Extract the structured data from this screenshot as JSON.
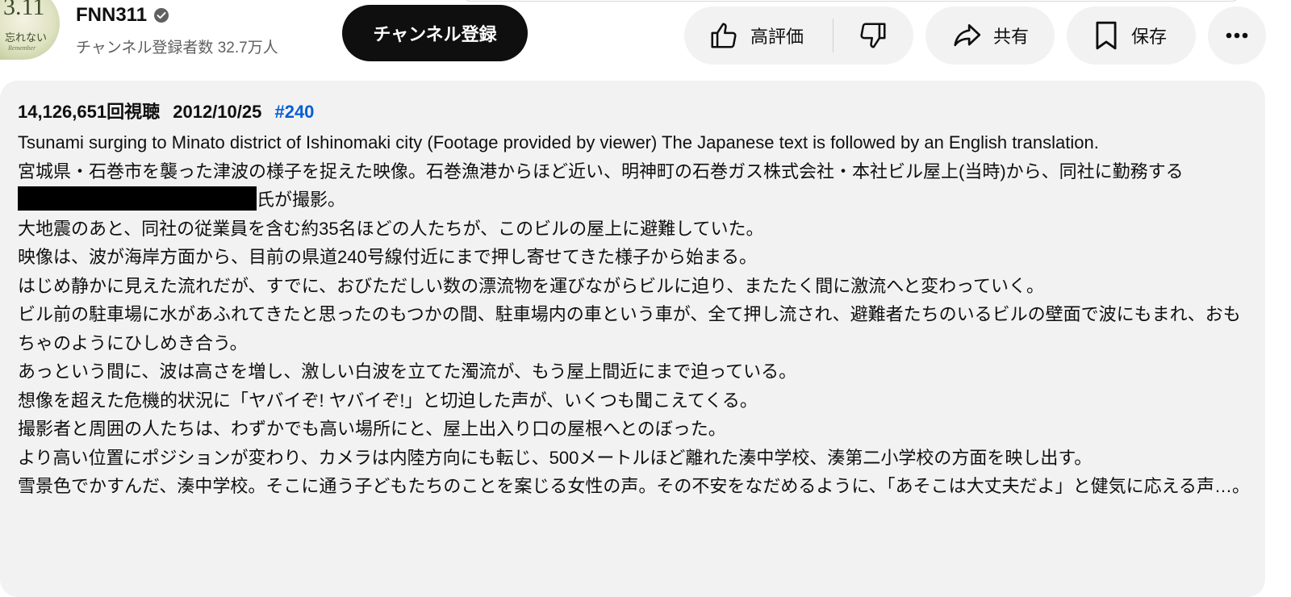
{
  "channel": {
    "avatar_text_main": "3.11",
    "avatar_text_sub": "忘れない",
    "avatar_text_script": "Remember",
    "name": "FNN311",
    "subscribers": "チャンネル登録者数 32.7万人",
    "subscribe_label": "チャンネル登録"
  },
  "actions": {
    "like_label": "高評価",
    "share_label": "共有",
    "save_label": "保存"
  },
  "description": {
    "views": "14,126,651回視聴",
    "date": "2012/10/25",
    "hashtag": "#240",
    "lines": [
      "Tsunami surging to Minato district of Ishinomaki city (Footage provided by viewer)  The Japanese text is followed by an English translation.",
      "宮城県・石巻市を襲った津波の様子を捉えた映像。石巻漁港からほど近い、明神町の石巻ガス株式会社・本社ビル屋上(当時)から、同社に勤務する",
      "氏が撮影。",
      "大地震のあと、同社の従業員を含む約35名ほどの人たちが、このビルの屋上に避難していた。",
      "映像は、波が海岸方面から、目前の県道240号線付近にまで押し寄せてきた様子から始まる。",
      "はじめ静かに見えた流れだが、すでに、おびただしい数の漂流物を運びながらビルに迫り、またたく間に激流へと変わっていく。",
      "ビル前の駐車場に水があふれてきたと思ったのもつかの間、駐車場内の車という車が、全て押し流され、避難者たちのいるビルの壁面で波にもまれ、おもちゃのようにひしめき合う。",
      "あっという間に、波は高さを増し、激しい白波を立てた濁流が、もう屋上間近にまで迫っている。",
      "想像を超えた危機的状況に「ヤバイぞ! ヤバイぞ!」と切迫した声が、いくつも聞こえてくる。",
      "撮影者と周囲の人たちは、わずかでも高い場所にと、屋上出入り口の屋根へとのぼった。",
      "より高い位置にポジションが変わり、カメラは内陸方向にも転じ、500メートルほど離れた湊中学校、湊第二小学校の方面を映し出す。",
      "雪景色でかすんだ、湊中学校。そこに通う子どもたちのことを案じる女性の声。その不安をなだめるように、「あそこは大丈夫だよ」と健気に応える声…。"
    ]
  },
  "colors": {
    "hashtag": "#065fd4",
    "subscribe_bg": "#0f0f0f",
    "pill_bg": "#f2f2f2",
    "secondary_text": "#606060"
  },
  "icons": [
    "verified-icon",
    "thumbs-up-icon",
    "thumbs-down-icon",
    "share-arrow-icon",
    "bookmark-icon",
    "more-dots-icon"
  ]
}
